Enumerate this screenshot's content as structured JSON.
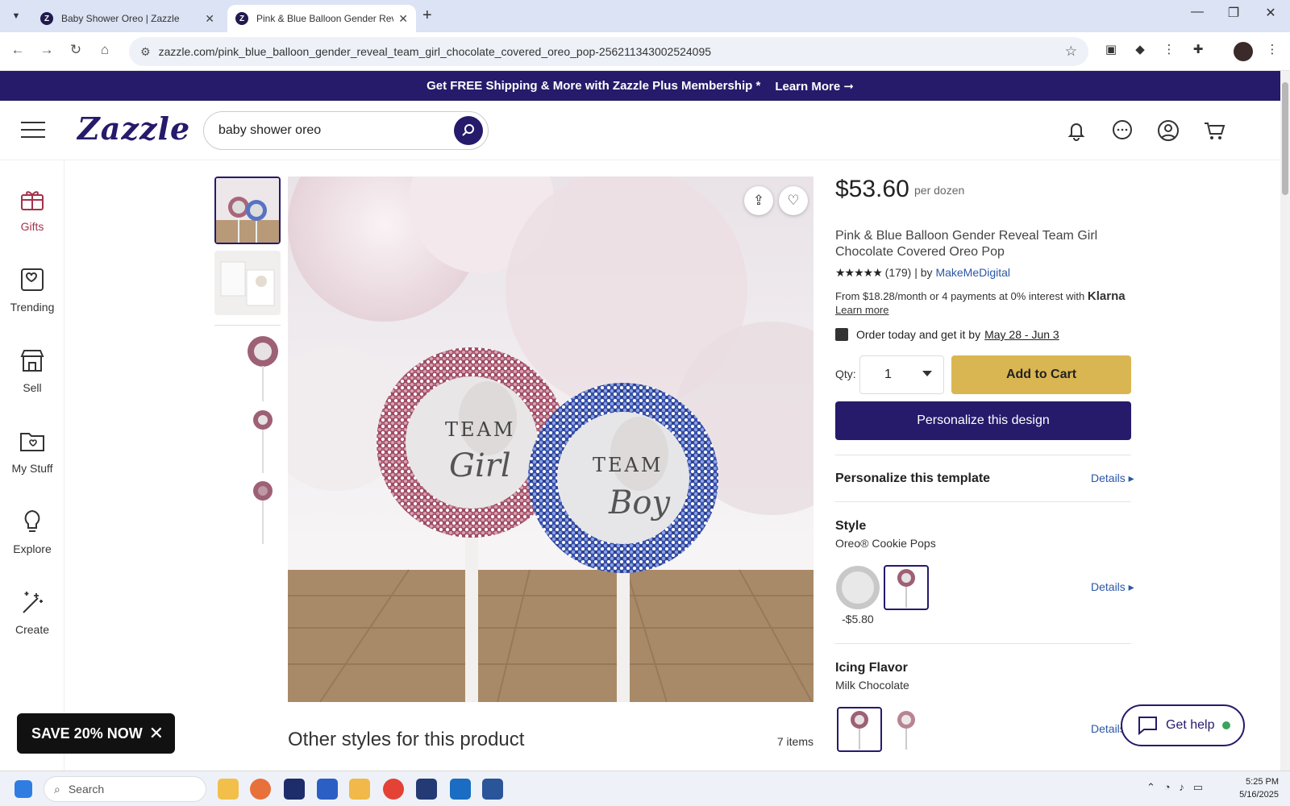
{
  "browser": {
    "tabs": [
      {
        "title": "Baby Shower Oreo | Zazzle",
        "active": false
      },
      {
        "title": "Pink & Blue Balloon Gender Reveal Team Girl Chocolate Covered Oreo Pop | Zazzle",
        "active": true
      }
    ],
    "url": "zazzle.com/pink_blue_balloon_gender_reveal_team_girl_chocolate_covered_oreo_pop-256211343002524095"
  },
  "promo": {
    "text": "Get FREE Shipping & More with Zazzle Plus Membership *",
    "link": "Learn More ➞"
  },
  "header": {
    "logo": "Zazzle",
    "search_value": "baby shower oreo"
  },
  "rail": {
    "items": [
      {
        "label": "Gifts"
      },
      {
        "label": "Trending"
      },
      {
        "label": "Sell"
      },
      {
        "label": "My Stuff"
      },
      {
        "label": "Explore"
      },
      {
        "label": "Create"
      }
    ]
  },
  "product": {
    "price": "$53.60",
    "price_unit": "per dozen",
    "title": "Pink & Blue Balloon Gender Reveal Team Girl Chocolate Covered Oreo Pop",
    "stars": "★★★★★",
    "reviews": "(179)",
    "by": "| by",
    "brand": "MakeMeDigital",
    "klarna_text": "From $18.28/month or 4 payments at 0% interest with",
    "klarna_brand": "Klarna",
    "klarna_learn": "Learn more",
    "delivery_text": "Order today and get it by",
    "delivery_date": "May 28 - Jun 3",
    "qty_label": "Qty:",
    "qty_value": "1",
    "add_to_cart": "Add to Cart",
    "personalize_btn": "Personalize this design",
    "template_title": "Personalize this template",
    "details": "Details",
    "style_title": "Style",
    "style_value": "Oreo® Cookie Pops",
    "style_price_diff": "-$5.80",
    "icing_title": "Icing Flavor",
    "icing_value": "Milk Chocolate",
    "image_texts": {
      "left_top": "TEAM",
      "left_script": "Girl",
      "right_top": "TEAM",
      "right_script": "Boy"
    }
  },
  "other_styles": {
    "title": "Other styles for this product",
    "count": "7 items"
  },
  "save_banner": "SAVE 20% NOW",
  "help": "Get help",
  "taskbar": {
    "search": "Search",
    "time": "5:25 PM",
    "date": "5/16/2025"
  },
  "colors": {
    "brand": "#261a6b",
    "cart": "#d9b652",
    "gifts": "#a3324b",
    "link": "#2a57a6"
  }
}
